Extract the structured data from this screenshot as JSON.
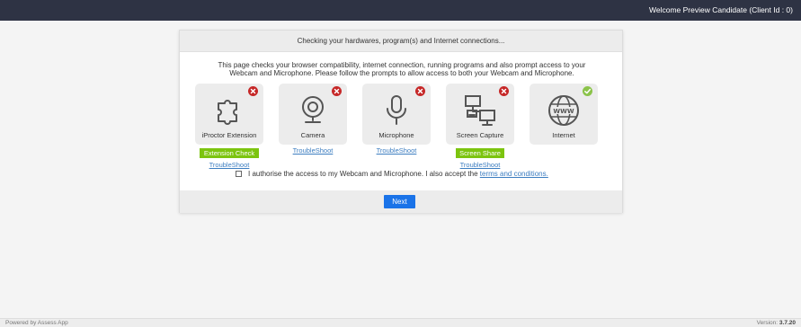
{
  "header": {
    "welcome": "Welcome Preview Candidate (Client Id : 0)"
  },
  "card": {
    "title": "Checking your hardwares, program(s) and Internet connections...",
    "description_line1": "This page checks your browser compatibility, internet connection, running programs and also prompt access to your",
    "description_line2": "Webcam and Microphone. Please follow the prompts to allow access to both your Webcam and Microphone.",
    "checks": [
      {
        "label": "iProctor Extension",
        "status": "fail",
        "icon": "puzzle-icon",
        "action": "Extension Check",
        "link": "TroubleShoot"
      },
      {
        "label": "Camera",
        "status": "fail",
        "icon": "webcam-icon",
        "link": "TroubleShoot"
      },
      {
        "label": "Microphone",
        "status": "fail",
        "icon": "microphone-icon",
        "link": "TroubleShoot"
      },
      {
        "label": "Screen Capture",
        "status": "fail",
        "icon": "monitors-icon",
        "action": "Screen Share",
        "link": "TroubleShoot"
      },
      {
        "label": "Internet",
        "status": "pass",
        "icon": "globe-www-icon"
      }
    ],
    "consent_text": "I authorise the access to my Webcam and Microphone. I also accept the",
    "terms_link": "terms and conditions.",
    "next_label": "Next"
  },
  "footer": {
    "powered_by": "Powered by Assess App",
    "version_label": "Version:",
    "version_value": "3.7.20"
  },
  "colors": {
    "topbar": "#2e3344",
    "fail": "#c62828",
    "pass": "#8bc34a",
    "action_green": "#7cc40f",
    "primary": "#1a73e8",
    "link": "#3c7dc0"
  }
}
